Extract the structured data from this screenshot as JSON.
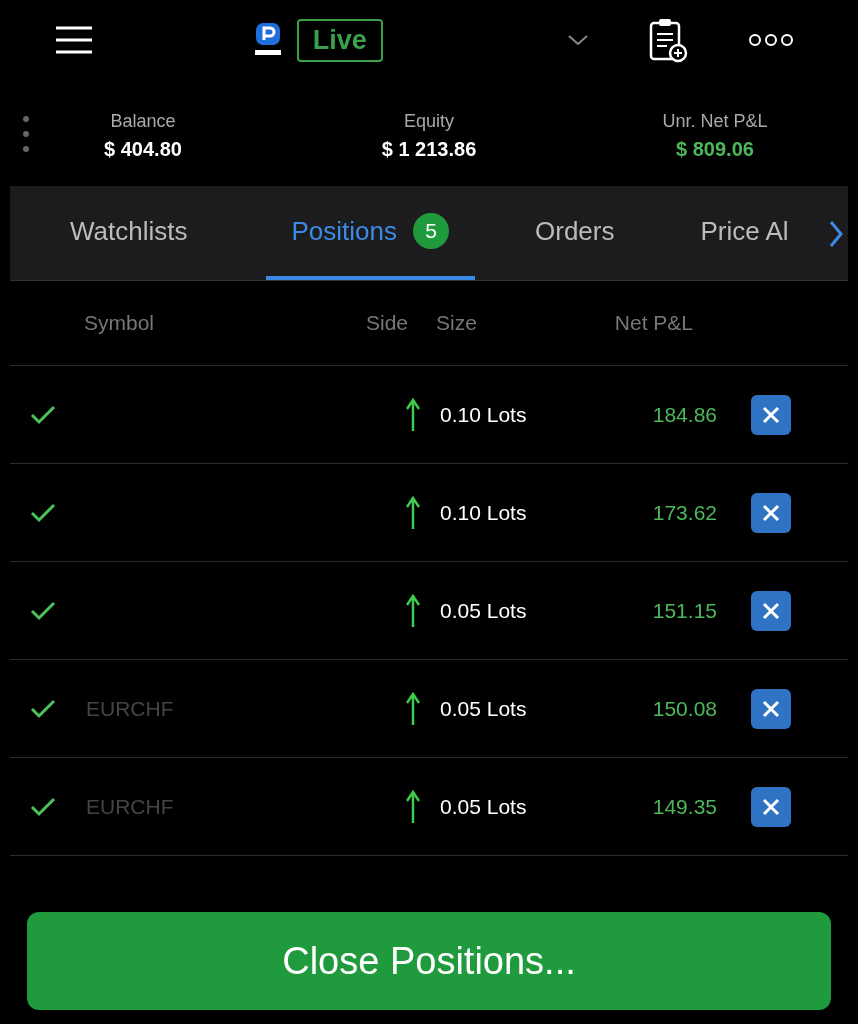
{
  "top_bar": {
    "mode": "Live"
  },
  "stats": [
    {
      "label": "Balance",
      "value": "$ 404.80",
      "kind": "plain"
    },
    {
      "label": "Equity",
      "value": "$ 1 213.86",
      "kind": "plain"
    },
    {
      "label": "Unr. Net P&L",
      "value": "$ 809.06",
      "kind": "profit"
    }
  ],
  "tabs": [
    {
      "label": "Watchlists",
      "selected": false
    },
    {
      "label": "Positions",
      "selected": true,
      "badge": "5"
    },
    {
      "label": "Orders",
      "selected": false
    },
    {
      "label": "Price Al",
      "selected": false
    }
  ],
  "table": {
    "columns": [
      "Symbol",
      "Side",
      "Size",
      "Net P&L"
    ],
    "rows": [
      {
        "checked": true,
        "kind": "buy",
        "size": "0.10 Lots",
        "pnl": "184.86"
      },
      {
        "checked": true,
        "kind": "buy",
        "size": "0.10 Lots",
        "pnl": "173.62"
      },
      {
        "checked": true,
        "kind": "buy",
        "size": "0.05 Lots",
        "pnl": "151.15"
      },
      {
        "checked": true,
        "symbol": "EURCHF",
        "kind": "buy",
        "size": "0.05 Lots",
        "pnl": "150.08"
      },
      {
        "checked": true,
        "symbol": "EURCHF",
        "kind": "buy",
        "size": "0.05 Lots",
        "pnl": "149.35"
      }
    ]
  },
  "close_button": "Close Positions..."
}
